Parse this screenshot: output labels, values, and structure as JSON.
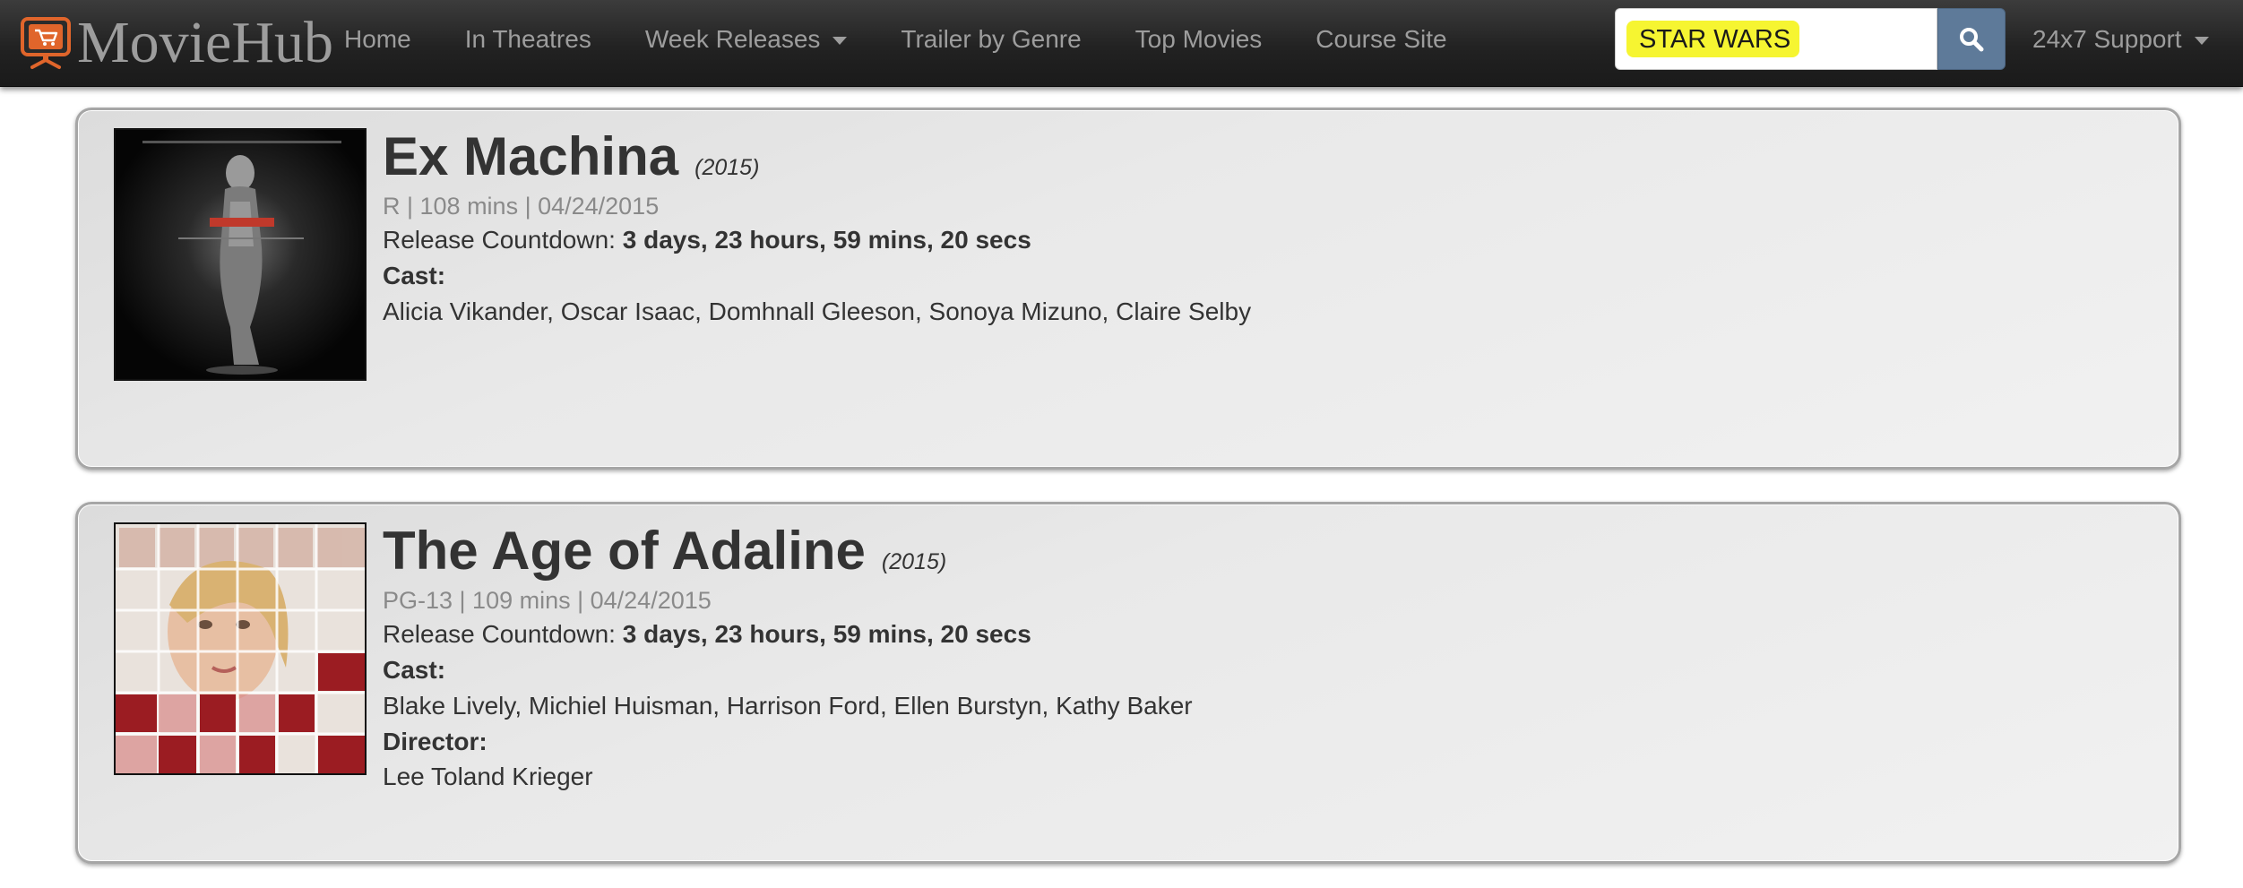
{
  "brand": {
    "name": "MovieHub",
    "icon": "monitor-cart-icon"
  },
  "nav": {
    "items": [
      {
        "label": "Home"
      },
      {
        "label": "In Theatres"
      },
      {
        "label": "Week Releases"
      },
      {
        "label": "Trailer by Genre"
      },
      {
        "label": "Top Movies"
      },
      {
        "label": "Course Site"
      }
    ],
    "support_label": "24x7 Support"
  },
  "search": {
    "value": "STAR WARS",
    "icon": "search-icon",
    "highlight_color": "#f6f531"
  },
  "movies": [
    {
      "title": "Ex Machina",
      "year": "(2015)",
      "meta": "R | 108 mins | 04/24/2015",
      "countdown_label": "Release Countdown:",
      "countdown_value": "3 days, 23 hours, 59 mins, 20 secs",
      "cast_label": "Cast:",
      "cast": "Alicia Vikander, Oscar Isaac, Domhnall Gleeson, Sonoya Mizuno, Claire Selby"
    },
    {
      "title": "The Age of Adaline",
      "year": "(2015)",
      "meta": "PG-13 | 109 mins | 04/24/2015",
      "countdown_label": "Release Countdown:",
      "countdown_value": "3 days, 23 hours, 59 mins, 20 secs",
      "cast_label": "Cast:",
      "cast": "Blake Lively, Michiel Huisman, Harrison Ford, Ellen Burstyn, Kathy Baker",
      "director_label": "Director:",
      "director": "Lee Toland Krieger"
    }
  ],
  "colors": {
    "navbar": "#222222",
    "nav_text": "#9d9d9d",
    "search_button": "#5e7a99",
    "brand_logo": "#e0652b"
  }
}
